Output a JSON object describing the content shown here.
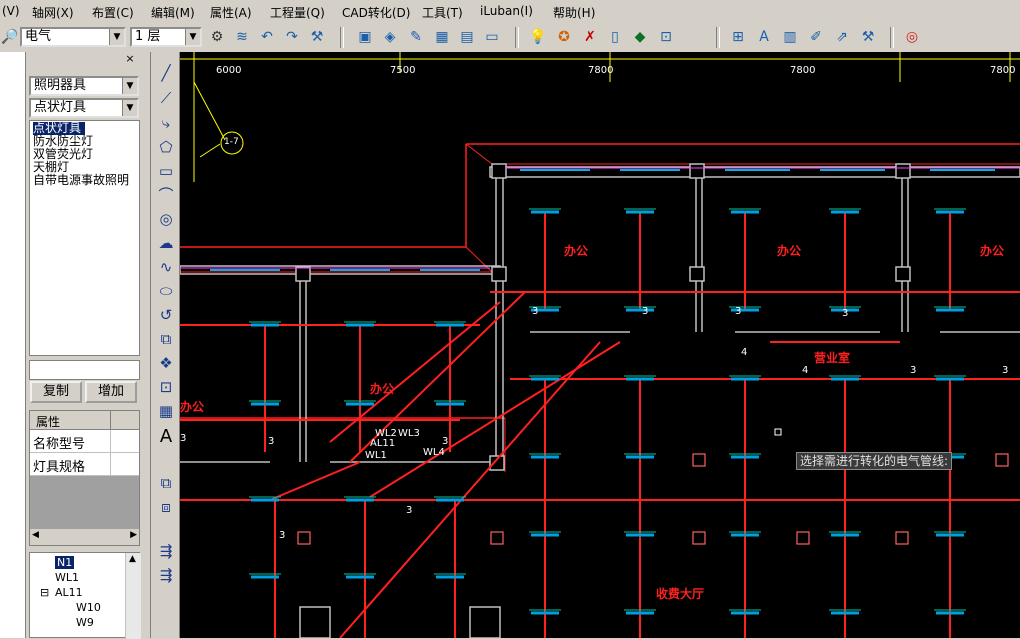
{
  "menu": [
    "(V)",
    "轴网(X)",
    "布置(C)",
    "编辑(M)",
    "属性(A)",
    "工程量(Q)",
    "CAD转化(D)",
    "工具(T)",
    "iLuban(I)",
    "帮助(H)"
  ],
  "toolbar": {
    "discipline": "电气",
    "floor": "1 层"
  },
  "left_panel": {
    "close_glyph": "×",
    "category": "照明器具",
    "subtype": "点状灯具",
    "items": [
      "点状灯具",
      "防水防尘灯",
      "双管荧光灯",
      "天棚灯",
      "自带电源事故照明"
    ],
    "selected_index": 0,
    "copy_button": "复制",
    "add_button": "增加",
    "props_header": "属性",
    "props": [
      "名称型号",
      "灯具规格"
    ],
    "tree": [
      "N1",
      "WL1",
      "AL11",
      "W10",
      "W9"
    ],
    "tree_expander": "⊟"
  },
  "canvas": {
    "dims": [
      "6000",
      "7500",
      "7800",
      "7800",
      "7800"
    ],
    "axis_bubble": "1-7",
    "rooms": [
      "办公",
      "办公",
      "办公",
      "办公",
      "办公",
      "营业室",
      "收费大厅"
    ],
    "circuit_labels": [
      "WL2",
      "WL3",
      "AL11",
      "WL1",
      "WL4"
    ],
    "counts": [
      "3",
      "3",
      "3",
      "3",
      "4",
      "4",
      "3",
      "3",
      "3",
      "3",
      "3",
      "3",
      "3"
    ],
    "prompt": "选择需进行转化的电气管线:"
  },
  "colors": {
    "wall": "#ff2020",
    "lamp": "#00c8a0",
    "lamp_bar": "#00a0e0",
    "dim": "#ffff00"
  }
}
